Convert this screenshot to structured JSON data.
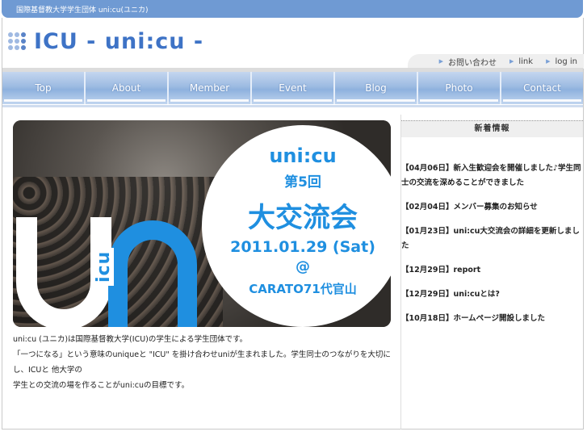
{
  "topbar": {
    "text": "国際基督教大学学生団体 uni:cu(ユニカ)"
  },
  "logo": {
    "text": "ICU - uni:cu -"
  },
  "subnav": [
    {
      "label": "お問い合わせ"
    },
    {
      "label": "link"
    },
    {
      "label": "log in"
    }
  ],
  "nav": [
    {
      "label": "Top"
    },
    {
      "label": "About"
    },
    {
      "label": "Member"
    },
    {
      "label": "Event"
    },
    {
      "label": "Blog"
    },
    {
      "label": "Photo"
    },
    {
      "label": "Contact"
    }
  ],
  "banner": {
    "title": "uni:cu",
    "edition": "第5回",
    "event": "大交流会",
    "date": "2011.01.29 (Sat)",
    "at": "@",
    "venue": "CARATO71代官山",
    "vertical_logo": "icu"
  },
  "description": {
    "line1": "uni:cu (ユニカ)は国際基督教大学(ICU)の学生による学生団体です。",
    "line2": "「一つになる」という意味のuniqueと \"ICU\" を掛け合わせuniが生まれました。学生同士のつながりを大切にし、ICUと 他大学の",
    "line3": "学生との交流の場を作ることがuni:cuの目標です。"
  },
  "sidebar": {
    "title": "新着情報",
    "items": [
      {
        "text": "【04月06日】新入生歓迎会を開催しました♪学生同士の交流を深めることができました"
      },
      {
        "text": "【02月04日】メンバー募集のお知らせ"
      },
      {
        "text": "【01月23日】uni:cu大交流会の詳細を更新しました"
      },
      {
        "text": "【12月29日】report"
      },
      {
        "text": "【12月29日】uni:cuとは?"
      },
      {
        "text": "【10月18日】ホームページ開設しました"
      }
    ]
  },
  "colors": {
    "accent": "#1f8fe0",
    "header": "#6f9ad3",
    "logo": "#3e73c6"
  }
}
